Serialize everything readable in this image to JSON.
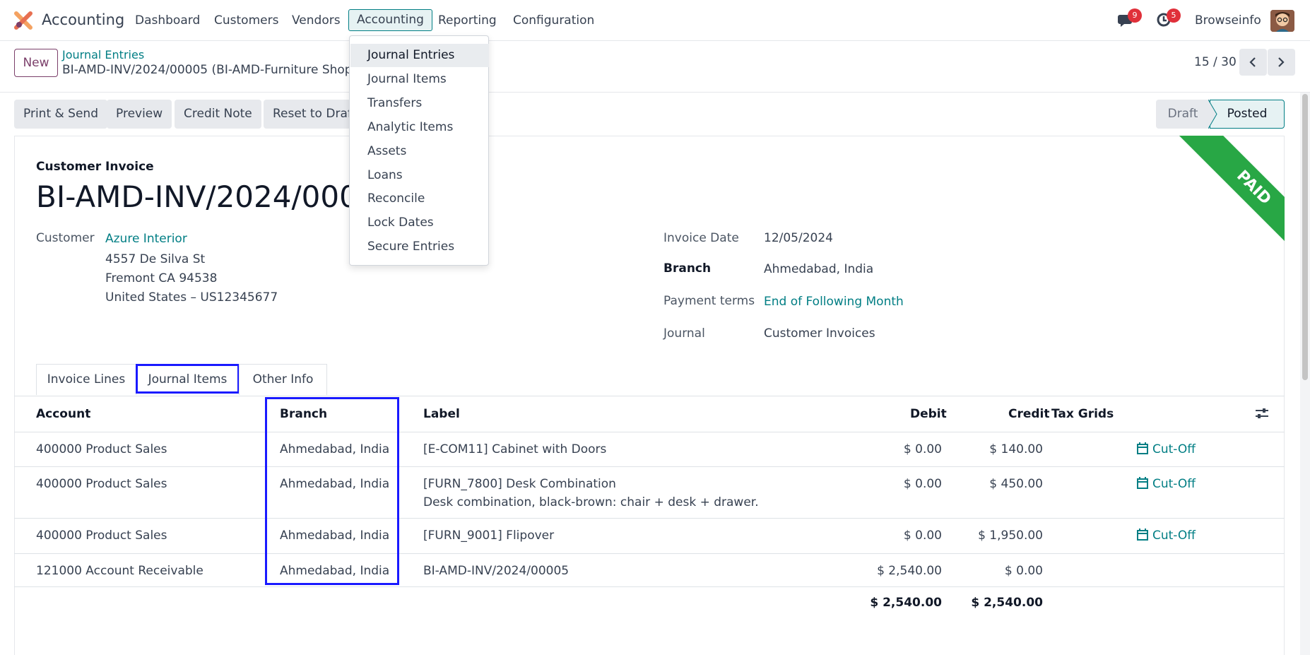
{
  "navbar": {
    "app_name": "Accounting",
    "menu": [
      "Dashboard",
      "Customers",
      "Vendors",
      "Accounting",
      "Reporting",
      "Configuration"
    ],
    "messages_count": "9",
    "activities_count": "5",
    "user_name": "Browseinfo"
  },
  "control": {
    "new_label": "New",
    "breadcrumb_parent": "Journal Entries",
    "breadcrumb_current": "BI-AMD-INV/2024/00005 (BI-AMD-Furniture Shop/…",
    "pager": "15 / 30"
  },
  "actions": {
    "print_send": "Print & Send",
    "preview": "Preview",
    "credit_note": "Credit Note",
    "reset_to_draft": "Reset to Draft"
  },
  "status": {
    "draft": "Draft",
    "posted": "Posted"
  },
  "ribbon": "PAID",
  "invoice": {
    "doc_type": "Customer Invoice",
    "number": "BI-AMD-INV/2024/00005",
    "customer_label": "Customer",
    "customer_name": "Azure Interior",
    "address_line1": "4557 De Silva St",
    "address_line2": "Fremont CA 94538",
    "address_line3": "United States – US12345677",
    "invoice_date_label": "Invoice Date",
    "invoice_date": "12/05/2024",
    "branch_label": "Branch",
    "branch": "Ahmedabad, India",
    "payment_terms_label": "Payment terms",
    "payment_terms": "End of Following Month",
    "journal_label": "Journal",
    "journal": "Customer Invoices"
  },
  "tabs": [
    "Invoice Lines",
    "Journal Items",
    "Other Info"
  ],
  "table": {
    "headers": {
      "account": "Account",
      "branch": "Branch",
      "label": "Label",
      "debit": "Debit",
      "credit": "Credit",
      "tax_grids": "Tax Grids"
    },
    "rows": [
      {
        "account": "400000 Product Sales",
        "branch": "Ahmedabad, India",
        "label": "[E-COM11] Cabinet with Doors",
        "label2": "",
        "debit": "$ 0.00",
        "credit": "$ 140.00",
        "cutoff": "Cut-Off"
      },
      {
        "account": "400000 Product Sales",
        "branch": "Ahmedabad, India",
        "label": "[FURN_7800] Desk Combination",
        "label2": "Desk combination, black-brown: chair + desk + drawer.",
        "debit": "$ 0.00",
        "credit": "$ 450.00",
        "cutoff": "Cut-Off"
      },
      {
        "account": "400000 Product Sales",
        "branch": "Ahmedabad, India",
        "label": "[FURN_9001] Flipover",
        "label2": "",
        "debit": "$ 0.00",
        "credit": "$ 1,950.00",
        "cutoff": "Cut-Off"
      },
      {
        "account": "121000 Account Receivable",
        "branch": "Ahmedabad, India",
        "label": "BI-AMD-INV/2024/00005",
        "label2": "",
        "debit": "$ 2,540.00",
        "credit": "$ 0.00",
        "cutoff": ""
      }
    ],
    "total_debit": "$ 2,540.00",
    "total_credit": "$ 2,540.00"
  },
  "dropdown": {
    "items": [
      "Journal Entries",
      "Journal Items",
      "Transfers",
      "Analytic Items",
      "Assets",
      "Loans",
      "Reconcile",
      "Lock Dates",
      "Secure Entries"
    ]
  },
  "colors": {
    "primary": "#017e84",
    "brand": "#7b3f6a",
    "paid_ribbon": "#28a745",
    "highlight_box": "#1a1aff"
  }
}
